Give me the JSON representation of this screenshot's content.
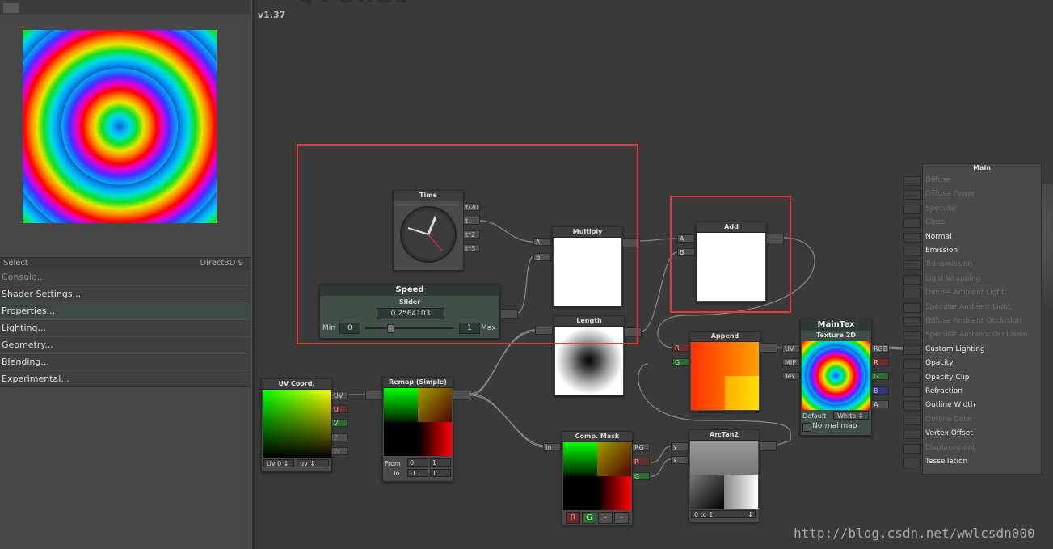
{
  "header": {
    "version": "v1.37"
  },
  "left_panel": {
    "select_label": "Select",
    "renderer_label": "Direct3D 9",
    "menu": [
      "Console...",
      "Shader Settings...",
      "Properties...",
      "Lighting...",
      "Geometry...",
      "Blending...",
      "Experimental..."
    ]
  },
  "nodes": {
    "time": {
      "title": "Time",
      "outputs": [
        "t/20",
        "t",
        "t*2",
        "t*3"
      ]
    },
    "speed": {
      "name": "Speed",
      "type": "Slider",
      "value": "0.2564103",
      "min_label": "Min",
      "min": "0",
      "max": "1",
      "max_label": "Max",
      "fill": 0.2564103
    },
    "multiply": {
      "title": "Multiply",
      "in_a": "A",
      "in_b": "B"
    },
    "add": {
      "title": "Add",
      "in_a": "A",
      "in_b": "B"
    },
    "length": {
      "title": "Length"
    },
    "append": {
      "title": "Append",
      "in_r": "R",
      "in_g": "G"
    },
    "uv_coord": {
      "title": "UV Coord.",
      "outputs": [
        "UV",
        "U",
        "V",
        "Z",
        "W"
      ],
      "uv_channel": "Uv 0",
      "mode": "uv"
    },
    "remap": {
      "title": "Remap (Simple)",
      "from_label": "From",
      "from_min": "0",
      "from_max": "1",
      "to_label": "To",
      "to_min": "-1",
      "to_max": "1"
    },
    "comp_mask": {
      "title": "Comp. Mask",
      "input": "In",
      "outputs": [
        "RG",
        "R",
        "G"
      ],
      "buttons": [
        "R",
        "G",
        "-",
        "-"
      ]
    },
    "arctan2": {
      "title": "ArcTan2",
      "inputs": [
        "y",
        "x"
      ],
      "mode": "0 to 1"
    },
    "maintex": {
      "name": "MainTex",
      "type": "Texture 2D",
      "inputs": [
        "UV",
        "MIP",
        "Tex"
      ],
      "outputs": [
        "RGB",
        "R",
        "G",
        "B",
        "A"
      ],
      "default_label": "Default",
      "default_value": "White",
      "normal_map": "Normal map"
    }
  },
  "main_node": {
    "title": "Main",
    "inputs": [
      {
        "label": "Diffuse",
        "enabled": false
      },
      {
        "label": "Diffuse Power",
        "enabled": false
      },
      {
        "label": "Specular",
        "enabled": false
      },
      {
        "label": "Gloss",
        "enabled": false
      },
      {
        "label": "Normal",
        "enabled": true
      },
      {
        "label": "Emission",
        "enabled": true
      },
      {
        "label": "Transmission",
        "enabled": false
      },
      {
        "label": "Light Wrapping",
        "enabled": false
      },
      {
        "label": "Diffuse Ambient Light",
        "enabled": false
      },
      {
        "label": "Specular Ambient Light",
        "enabled": false
      },
      {
        "label": "Diffuse Ambient Occlusion",
        "enabled": false
      },
      {
        "label": "Specular Ambient Occlusion",
        "enabled": false
      },
      {
        "label": "Custom Lighting",
        "enabled": true
      },
      {
        "label": "Opacity",
        "enabled": true
      },
      {
        "label": "Opacity Clip",
        "enabled": true
      },
      {
        "label": "Refraction",
        "enabled": true
      },
      {
        "label": "Outline Width",
        "enabled": true
      },
      {
        "label": "Outline Color",
        "enabled": false
      },
      {
        "label": "Vertex Offset",
        "enabled": true
      },
      {
        "label": "Displacement",
        "enabled": false
      },
      {
        "label": "Tessellation",
        "enabled": true
      }
    ]
  },
  "watermark": "http://blog.csdn.net/wwlcsdn000",
  "colors": {
    "highlight": "#e03c3c",
    "panel": "#474747",
    "canvas": "#3a3a3a"
  }
}
